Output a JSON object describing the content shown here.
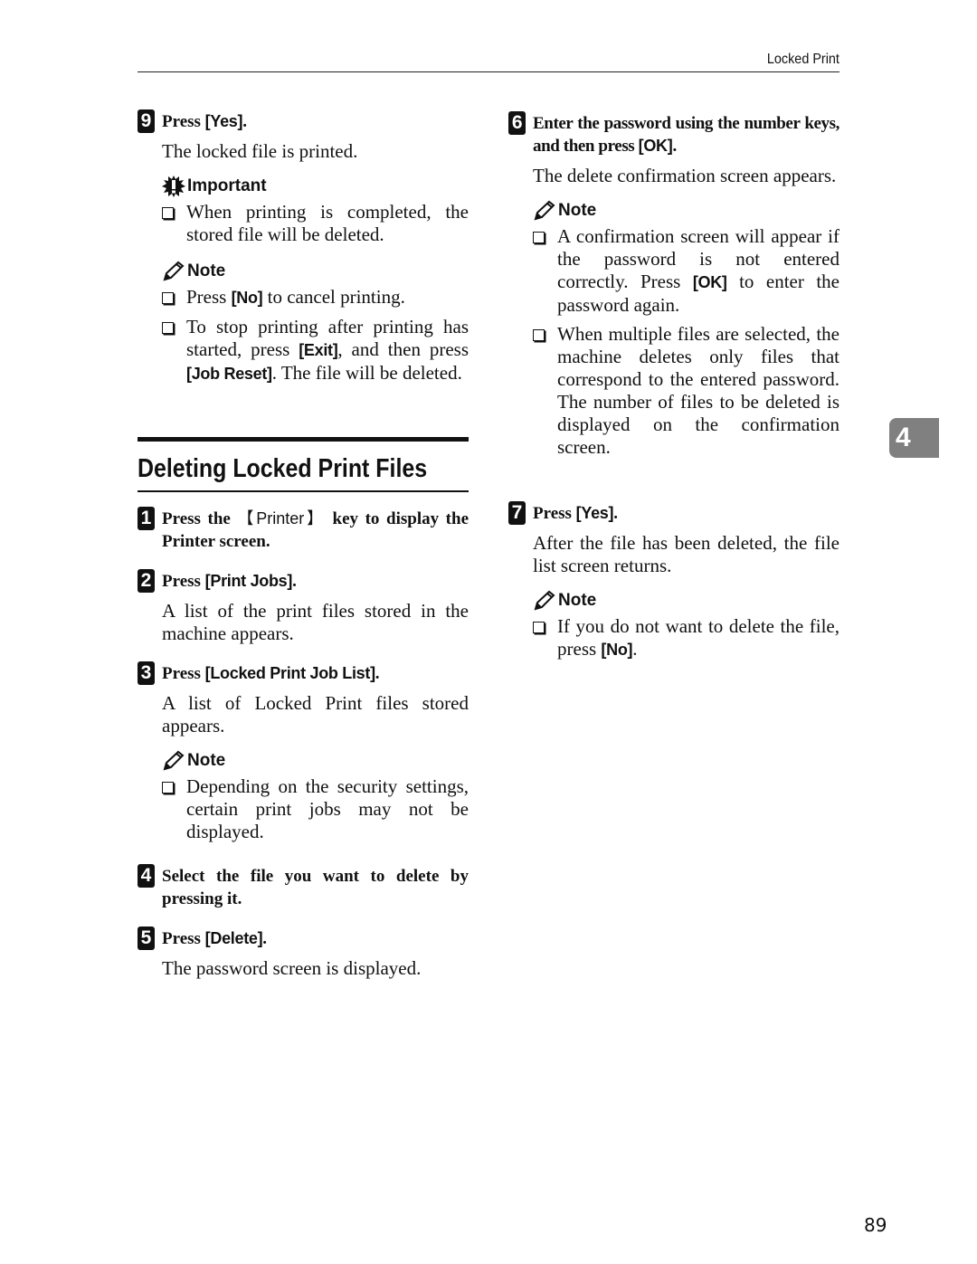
{
  "header": {
    "title": "Locked Print"
  },
  "chapter_tab": "4",
  "page_number": "89",
  "section_title": "Deleting Locked Print Files",
  "callout_labels": {
    "important": "Important",
    "note": "Note"
  },
  "left_column": {
    "step9": {
      "num": "9",
      "pre": "Press ",
      "key": "[Yes]",
      "post": ".",
      "body": "The locked file is printed.",
      "important": [
        "When printing is completed, the stored file will be deleted."
      ],
      "note": [
        {
          "pre": "Press ",
          "key": "[No]",
          "post": " to cancel printing."
        },
        {
          "pre": "To stop printing after printing has started, press ",
          "key": "[Exit]",
          "mid": ", and then press ",
          "key2": "[Job Reset]",
          "post": ". The file will be deleted."
        }
      ]
    },
    "step1": {
      "num": "1",
      "pre": "Press the ",
      "key": "【Printer】",
      "post": " key to display the Printer screen."
    },
    "step2": {
      "num": "2",
      "pre": "Press ",
      "key": "[Print Jobs]",
      "post": ".",
      "body": "A list of the print files stored in the machine appears."
    },
    "step3": {
      "num": "3",
      "pre": "Press ",
      "key": "[Locked Print Job List]",
      "post": ".",
      "body": "A list of Locked Print files stored appears.",
      "note": [
        "Depending on the security settings, certain print jobs may not be displayed."
      ]
    },
    "step4": {
      "num": "4",
      "text": "Select the file you want to delete by pressing it."
    },
    "step5": {
      "num": "5",
      "pre": "Press ",
      "key": "[Delete]",
      "post": ".",
      "body": "The password screen is displayed."
    }
  },
  "right_column": {
    "step6": {
      "num": "6",
      "pre": "Enter the password using the number keys, and then press ",
      "key": "[OK]",
      "post": ".",
      "body": "The delete confirmation screen appears.",
      "note": [
        {
          "pre": "A confirmation screen will appear if the password is not entered correctly. Press ",
          "key": "[OK]",
          "post": " to enter the password again."
        },
        {
          "pre": "When multiple files are selected, the machine deletes only files that correspond to the entered password. The number of files to be deleted is displayed on the confirmation screen."
        }
      ]
    },
    "step7": {
      "num": "7",
      "pre": "Press ",
      "key": "[Yes]",
      "post": ".",
      "body": "After the file has been deleted, the file list screen returns.",
      "note": [
        {
          "pre": "If you do not want to delete the file, press ",
          "key": "[No]",
          "post": "."
        }
      ]
    }
  }
}
